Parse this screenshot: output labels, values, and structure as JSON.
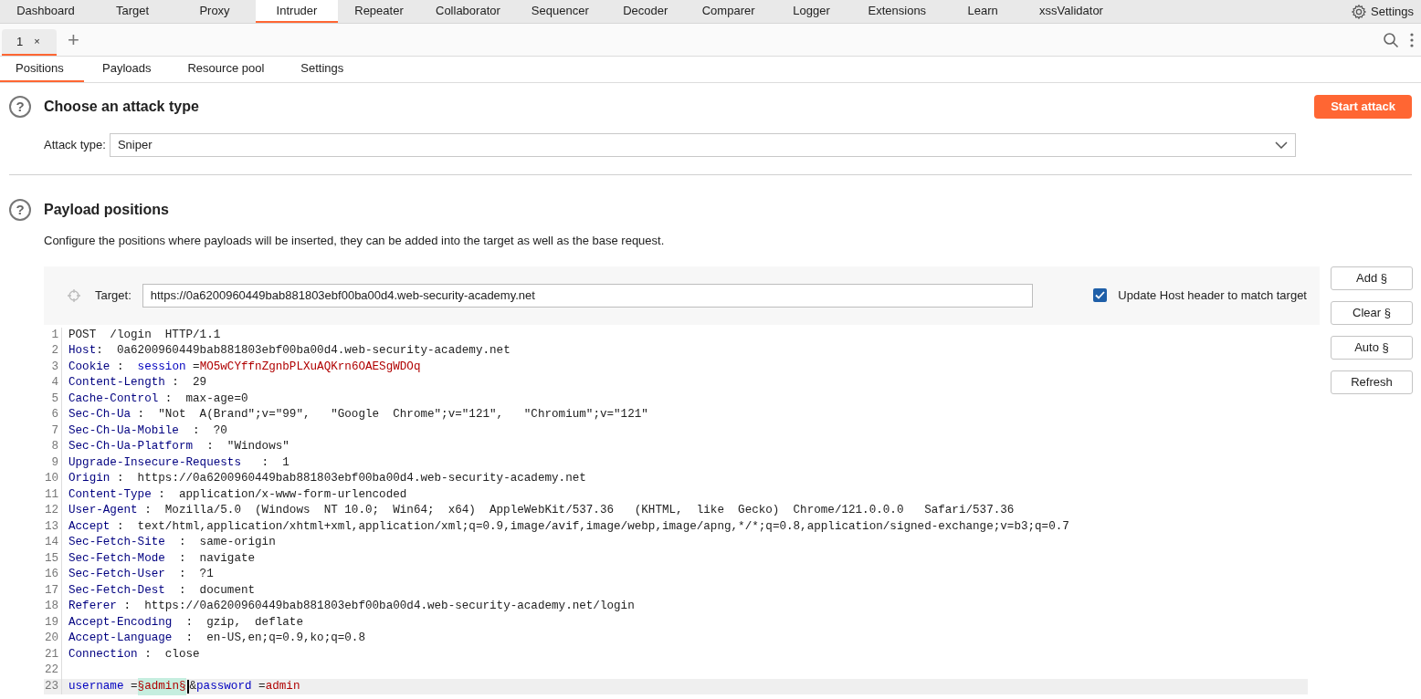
{
  "main_tabs": [
    {
      "label": "Dashboard",
      "selected": false
    },
    {
      "label": "Target",
      "selected": false
    },
    {
      "label": "Proxy",
      "selected": false
    },
    {
      "label": "Intruder",
      "selected": true
    },
    {
      "label": "Repeater",
      "selected": false
    },
    {
      "label": "Collaborator",
      "selected": false
    },
    {
      "label": "Sequencer",
      "selected": false
    },
    {
      "label": "Decoder",
      "selected": false
    },
    {
      "label": "Comparer",
      "selected": false
    },
    {
      "label": "Logger",
      "selected": false
    },
    {
      "label": "Extensions",
      "selected": false
    },
    {
      "label": "Learn",
      "selected": false
    },
    {
      "label": "xssValidator",
      "selected": false
    }
  ],
  "settings_link": "Settings",
  "attack_tabs": [
    {
      "label": "1",
      "close": "×",
      "selected": true
    }
  ],
  "add_tab": "+",
  "sub_tabs": [
    {
      "label": "Positions",
      "selected": true
    },
    {
      "label": "Payloads",
      "selected": false
    },
    {
      "label": "Resource pool",
      "selected": false
    },
    {
      "label": "Settings",
      "selected": false
    }
  ],
  "attack_type_section": {
    "help": "?",
    "title": "Choose an attack type",
    "start_button": "Start attack",
    "attack_type_label": "Attack type:",
    "attack_type_value": "Sniper"
  },
  "payload_section": {
    "help": "?",
    "title": "Payload positions",
    "description": "Configure the positions where payloads will be inserted, they can be added into the target as well as the base request.",
    "target_label": "Target:",
    "target_value": "https://0a6200960449bab881803ebf00ba00d4.web-security-academy.net",
    "update_host": {
      "label": "Update Host header to match target",
      "checked": true
    },
    "buttons": [
      "Add §",
      "Clear §",
      "Auto §",
      "Refresh"
    ]
  },
  "request_lines": [
    {
      "number": "1",
      "current": false,
      "tokens": [
        {
          "kind": "plain",
          "text": "POST  /login  HTTP/1.1"
        }
      ]
    },
    {
      "number": "2",
      "current": false,
      "tokens": [
        {
          "kind": "header",
          "text": "Host"
        },
        {
          "kind": "plain",
          "text": ":  0a6200960449bab881803ebf00ba00d4.web-security-academy.net"
        }
      ]
    },
    {
      "number": "3",
      "current": false,
      "tokens": [
        {
          "kind": "header",
          "text": "Cookie"
        },
        {
          "kind": "plain",
          "text": " :  "
        },
        {
          "kind": "param",
          "text": "session"
        },
        {
          "kind": "plain",
          "text": " ="
        },
        {
          "kind": "value",
          "text": "MO5wCYffnZgnbPLXuAQKrn6OAESgWDOq"
        }
      ]
    },
    {
      "number": "4",
      "current": false,
      "tokens": [
        {
          "kind": "header",
          "text": "Content-Length"
        },
        {
          "kind": "plain",
          "text": " :  29"
        }
      ]
    },
    {
      "number": "5",
      "current": false,
      "tokens": [
        {
          "kind": "header",
          "text": "Cache-Control"
        },
        {
          "kind": "plain",
          "text": " :  max-age=0"
        }
      ]
    },
    {
      "number": "6",
      "current": false,
      "tokens": [
        {
          "kind": "header",
          "text": "Sec-Ch-Ua"
        },
        {
          "kind": "plain",
          "text": " :  \"Not  A(Brand\";v=\"99\",   \"Google  Chrome\";v=\"121\",   \"Chromium\";v=\"121\""
        }
      ]
    },
    {
      "number": "7",
      "current": false,
      "tokens": [
        {
          "kind": "header",
          "text": "Sec-Ch-Ua-Mobile"
        },
        {
          "kind": "plain",
          "text": "  :  ?0"
        }
      ]
    },
    {
      "number": "8",
      "current": false,
      "tokens": [
        {
          "kind": "header",
          "text": "Sec-Ch-Ua-Platform"
        },
        {
          "kind": "plain",
          "text": "  :  \"Windows\""
        }
      ]
    },
    {
      "number": "9",
      "current": false,
      "tokens": [
        {
          "kind": "header",
          "text": "Upgrade-Insecure-Requests"
        },
        {
          "kind": "plain",
          "text": "   :  1"
        }
      ]
    },
    {
      "number": "10",
      "current": false,
      "tokens": [
        {
          "kind": "header",
          "text": "Origin"
        },
        {
          "kind": "plain",
          "text": " :  https://0a6200960449bab881803ebf00ba00d4.web-security-academy.net"
        }
      ]
    },
    {
      "number": "11",
      "current": false,
      "tokens": [
        {
          "kind": "header",
          "text": "Content-Type"
        },
        {
          "kind": "plain",
          "text": " :  application/x-www-form-urlencoded"
        }
      ]
    },
    {
      "number": "12",
      "current": false,
      "tokens": [
        {
          "kind": "header",
          "text": "User-Agent"
        },
        {
          "kind": "plain",
          "text": " :  Mozilla/5.0  (Windows  NT 10.0;  Win64;  x64)  AppleWebKit/537.36   (KHTML,  like  Gecko)  Chrome/121.0.0.0   Safari/537.36"
        }
      ]
    },
    {
      "number": "13",
      "current": false,
      "tokens": [
        {
          "kind": "header",
          "text": "Accept"
        },
        {
          "kind": "plain",
          "text": " :  text/html,application/xhtml+xml,application/xml;q=0.9,image/avif,image/webp,image/apng,*/*;q=0.8,application/signed-exchange;v=b3;q=0.7"
        }
      ]
    },
    {
      "number": "14",
      "current": false,
      "tokens": [
        {
          "kind": "header",
          "text": "Sec-Fetch-Site"
        },
        {
          "kind": "plain",
          "text": "  :  same-origin"
        }
      ]
    },
    {
      "number": "15",
      "current": false,
      "tokens": [
        {
          "kind": "header",
          "text": "Sec-Fetch-Mode"
        },
        {
          "kind": "plain",
          "text": "  :  navigate"
        }
      ]
    },
    {
      "number": "16",
      "current": false,
      "tokens": [
        {
          "kind": "header",
          "text": "Sec-Fetch-User"
        },
        {
          "kind": "plain",
          "text": "  :  ?1"
        }
      ]
    },
    {
      "number": "17",
      "current": false,
      "tokens": [
        {
          "kind": "header",
          "text": "Sec-Fetch-Dest"
        },
        {
          "kind": "plain",
          "text": "  :  document"
        }
      ]
    },
    {
      "number": "18",
      "current": false,
      "tokens": [
        {
          "kind": "header",
          "text": "Referer"
        },
        {
          "kind": "plain",
          "text": " :  https://0a6200960449bab881803ebf00ba00d4.web-security-academy.net/login"
        }
      ]
    },
    {
      "number": "19",
      "current": false,
      "tokens": [
        {
          "kind": "header",
          "text": "Accept-Encoding"
        },
        {
          "kind": "plain",
          "text": "  :  gzip,  deflate"
        }
      ]
    },
    {
      "number": "20",
      "current": false,
      "tokens": [
        {
          "kind": "header",
          "text": "Accept-Language"
        },
        {
          "kind": "plain",
          "text": "  :  en-US,en;q=0.9,ko;q=0.8"
        }
      ]
    },
    {
      "number": "21",
      "current": false,
      "tokens": [
        {
          "kind": "header",
          "text": "Connection"
        },
        {
          "kind": "plain",
          "text": " :  close"
        }
      ]
    },
    {
      "number": "22",
      "current": false
    },
    {
      "number": "23",
      "current": true,
      "tokens": [
        {
          "kind": "param",
          "text": "username"
        },
        {
          "kind": "plain",
          "text": " ="
        },
        {
          "kind": "payload",
          "text": "§admin§"
        },
        {
          "kind": "cursor"
        },
        {
          "kind": "plain",
          "text": "&"
        },
        {
          "kind": "param",
          "text": "password"
        },
        {
          "kind": "plain",
          "text": " ="
        },
        {
          "kind": "value",
          "text": "admin"
        }
      ]
    }
  ]
}
